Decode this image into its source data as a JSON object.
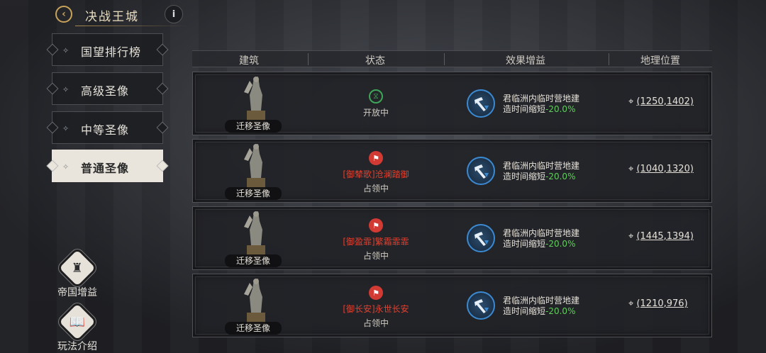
{
  "header": {
    "title": "决战王城",
    "back_icon": "back-arrow-icon",
    "info_label": "i"
  },
  "sidebar": {
    "items": [
      {
        "label": "国望排行榜",
        "active": false
      },
      {
        "label": "高级圣像",
        "active": false
      },
      {
        "label": "中等圣像",
        "active": false
      },
      {
        "label": "普通圣像",
        "active": true
      }
    ],
    "bottom": [
      {
        "label": "帝国增益",
        "icon": "castle-icon"
      },
      {
        "label": "玩法介绍",
        "icon": "book-icon"
      }
    ]
  },
  "table": {
    "columns": [
      "建筑",
      "状态",
      "效果增益",
      "地理位置"
    ],
    "rows": [
      {
        "move_label": "迁移圣像",
        "status_icon": "hourglass-icon",
        "status": "开放中",
        "occupier": "",
        "effect_line1": "君临洲内临时营地建",
        "effect_line2_prefix": "造时间缩短",
        "effect_pct": "-20.0%",
        "location": "(1250,1402)"
      },
      {
        "move_label": "迁移圣像",
        "status_icon": "flag-icon",
        "status": "占领中",
        "occupier": "[御辇歌]沧澜踏御",
        "effect_line1": "君临洲内临时营地建",
        "effect_line2_prefix": "造时间缩短",
        "effect_pct": "-20.0%",
        "location": "(1040,1320)"
      },
      {
        "move_label": "迁移圣像",
        "status_icon": "flag-icon",
        "status": "占领中",
        "occupier": "[御盈霏]繁霜霏霏",
        "effect_line1": "君临洲内临时营地建",
        "effect_line2_prefix": "造时间缩短",
        "effect_pct": "-20.0%",
        "location": "(1445,1394)"
      },
      {
        "move_label": "迁移圣像",
        "status_icon": "flag-icon",
        "status": "占领中",
        "occupier": "[御长安]永世长安",
        "effect_line1": "君临洲内临时营地建",
        "effect_line2_prefix": "造时间缩短",
        "effect_pct": "-20.0%",
        "location": "(1210,976)"
      }
    ]
  },
  "colors": {
    "accent_gold": "#c9a35a",
    "occupier_red": "#e2402f",
    "bonus_green": "#5fcf5a",
    "effect_blue": "#3b8ad1",
    "open_green": "#3fa55a"
  }
}
